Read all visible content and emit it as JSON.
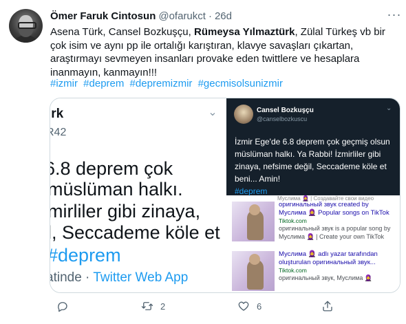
{
  "author": {
    "name": "Ömer Faruk Cintosun",
    "handle": "@ofarukct",
    "separator": "·",
    "time": "26d"
  },
  "more_icon": "more-dots-icon",
  "tweet": {
    "text_part1": "Asena Türk, Cansel Bozkuşçu, ",
    "text_bold": "Rümeysa Yılmaztürk",
    "text_part2": ", Zülal Türkeş vb bir çok isim ve aynı pp ile ortalığı karıştıran, klavye savaşları çıkartan, araştırmayı sevmeyen insanları provake eden twittlere ve hesaplara inanmayın, kanmayın!!!",
    "hashtags": [
      "#izmir",
      "#deprem",
      "#depremizmir",
      "#gecmisolsunizmir"
    ]
  },
  "media_left": {
    "line1": "ırk",
    "line2": "R42",
    "line3": "6.8  deprem çok",
    "line4": " müslüman halkı.",
    "line5": "mirliler gibi zinaya,",
    "line6": "l, Seccademe köle et",
    "line7": "#deprem",
    "line8_prefix": "atinde · ",
    "line8_app": "Twitter Web App"
  },
  "media_right": {
    "name": "Cansel Bozkuşçu",
    "handle": "@canselbozkuscu",
    "text": "İzmir Ege'de 6.8  deprem çok geçmiş olsun müslüman halkı. Ya Rabbi! İzmirliler gibi zinaya, nefsime değil, Seccademe köle et beni... Amin!",
    "tag": "#deprem",
    "strip": "Муслима 🧕 | Создавайте свои видео",
    "results": [
      {
        "title": "оригинальный звук created by Муслима 🧕 Popular songs on TikTok",
        "url": "Tiktok.com",
        "desc": "оригинальный звук is a popular song by Муслима 🧕 | Create your own TikTok"
      },
      {
        "title": "Муслима 🧕 adlı yazar tarafından oluşturulan оригинальный звук...",
        "url": "Tiktok.com",
        "desc": "оригинальный звук, Муслима 🧕"
      }
    ]
  },
  "actions": {
    "reply_count": "",
    "retweet_count": "2",
    "like_count": "6",
    "share_count": ""
  },
  "colors": {
    "link": "#1d9bf0",
    "muted": "#536471",
    "dark_card": "#15202b"
  }
}
